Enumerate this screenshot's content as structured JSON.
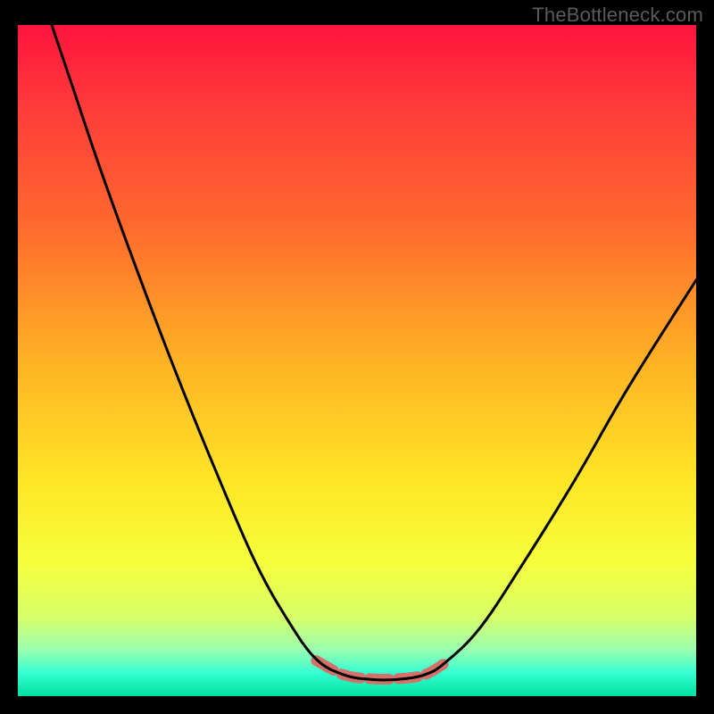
{
  "attribution": {
    "text": "TheBottleneck.com"
  },
  "chart_data": {
    "type": "line",
    "title": "",
    "xlabel": "",
    "ylabel": "",
    "xlim": [
      0,
      100
    ],
    "ylim": [
      0,
      100
    ],
    "grid": false,
    "legend": false,
    "background_gradient_stops": [
      {
        "offset": 0.0,
        "color": "#ff143e"
      },
      {
        "offset": 0.12,
        "color": "#ff3a3a"
      },
      {
        "offset": 0.3,
        "color": "#ff6a2e"
      },
      {
        "offset": 0.5,
        "color": "#ffb224"
      },
      {
        "offset": 0.68,
        "color": "#ffe626"
      },
      {
        "offset": 0.8,
        "color": "#f6ff3c"
      },
      {
        "offset": 0.88,
        "color": "#d8ff66"
      },
      {
        "offset": 0.93,
        "color": "#9dffb0"
      },
      {
        "offset": 0.965,
        "color": "#35ffd2"
      },
      {
        "offset": 1.0,
        "color": "#00e09e"
      }
    ],
    "series": [
      {
        "name": "bottleneck-curve",
        "stroke": "#000000",
        "stroke_width": 3,
        "points": [
          {
            "x": 5,
            "y": 100
          },
          {
            "x": 8,
            "y": 91
          },
          {
            "x": 12,
            "y": 79
          },
          {
            "x": 17,
            "y": 65
          },
          {
            "x": 23,
            "y": 49
          },
          {
            "x": 29,
            "y": 34
          },
          {
            "x": 35,
            "y": 20
          },
          {
            "x": 40,
            "y": 11
          },
          {
            "x": 44,
            "y": 5.5
          },
          {
            "x": 48,
            "y": 3.2
          },
          {
            "x": 52,
            "y": 2.5
          },
          {
            "x": 56,
            "y": 2.5
          },
          {
            "x": 60,
            "y": 3.2
          },
          {
            "x": 63,
            "y": 5
          },
          {
            "x": 68,
            "y": 10
          },
          {
            "x": 74,
            "y": 19
          },
          {
            "x": 82,
            "y": 32
          },
          {
            "x": 90,
            "y": 46
          },
          {
            "x": 100,
            "y": 62
          }
        ]
      },
      {
        "name": "minimum-highlight",
        "stroke": "#d6706a",
        "stroke_width": 12,
        "linecap": "round",
        "dash": "22 10",
        "points": [
          {
            "x": 44,
            "y": 5.3
          },
          {
            "x": 48,
            "y": 3.2
          },
          {
            "x": 52,
            "y": 2.6
          },
          {
            "x": 56,
            "y": 2.6
          },
          {
            "x": 60,
            "y": 3.2
          },
          {
            "x": 63.5,
            "y": 5.3
          }
        ]
      }
    ]
  }
}
